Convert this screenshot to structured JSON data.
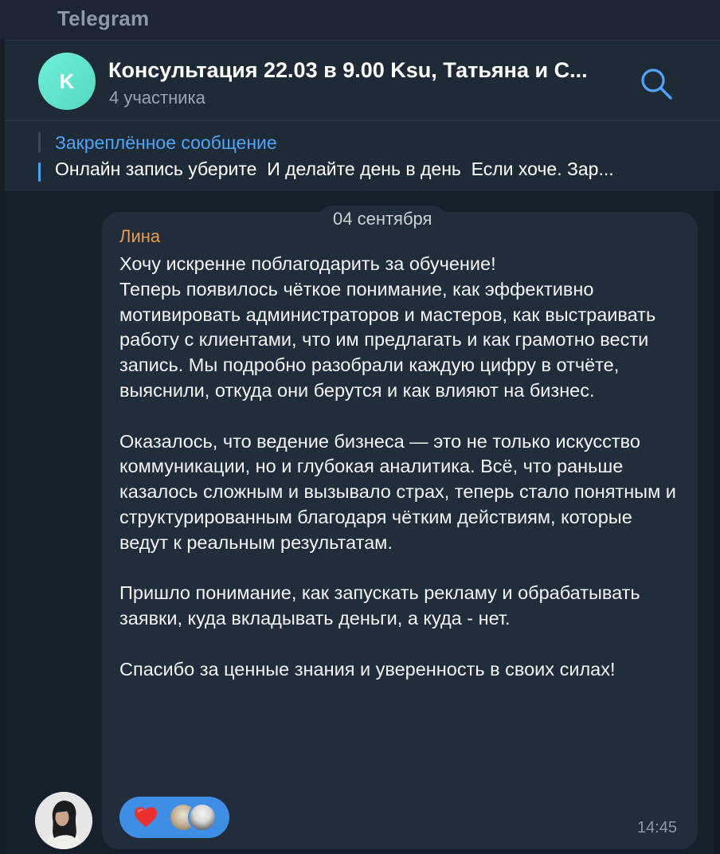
{
  "app": {
    "title": "Telegram"
  },
  "header": {
    "avatar_letter": "K",
    "chat_title": "Консультация 22.03 в 9.00 Ksu, Татьяна и С...",
    "participants": "4 участника",
    "search_icon": "search-icon"
  },
  "pinned": {
    "title": "Закреплённое сообщение",
    "text": "Онлайн запись уберите  И делайте день в день  Если хоче. Зар..."
  },
  "date_separator": "04 сентября",
  "message": {
    "sender": "Лина",
    "text": "Хочу искренне поблагодарить за обучение!\nТеперь появилось чёткое понимание, как эффективно мотивировать администраторов и мастеров, как выстраивать работу с клиентами, что им предлагать и как грамотно вести запись. Мы подробно разобрали каждую цифру в отчёте, выяснили, откуда они берутся и как влияют на бизнес.\n\nОказалось, что ведение бизнеса — это не только искусство коммуникации, но и глубокая аналитика. Всё, что раньше казалось сложным и вызывало страх, теперь стало понятным и структурированным благодаря чётким действиям, которые ведут к реальным результатам.\n\nПришло понимание, как запускать рекламу и обрабатывать заявки, куда вкладывать деньги, а куда - нет.\n\nСпасибо за ценные знания и уверенность в своих силах!",
    "time": "14:45",
    "reaction_icon": "heart-icon"
  },
  "colors": {
    "accent": "#4ea4f6",
    "sender": "#e99a50",
    "reaction_bg": "#3e8ee6",
    "avatar_k": "#5fe3cc",
    "bubble": "#212d3b"
  }
}
